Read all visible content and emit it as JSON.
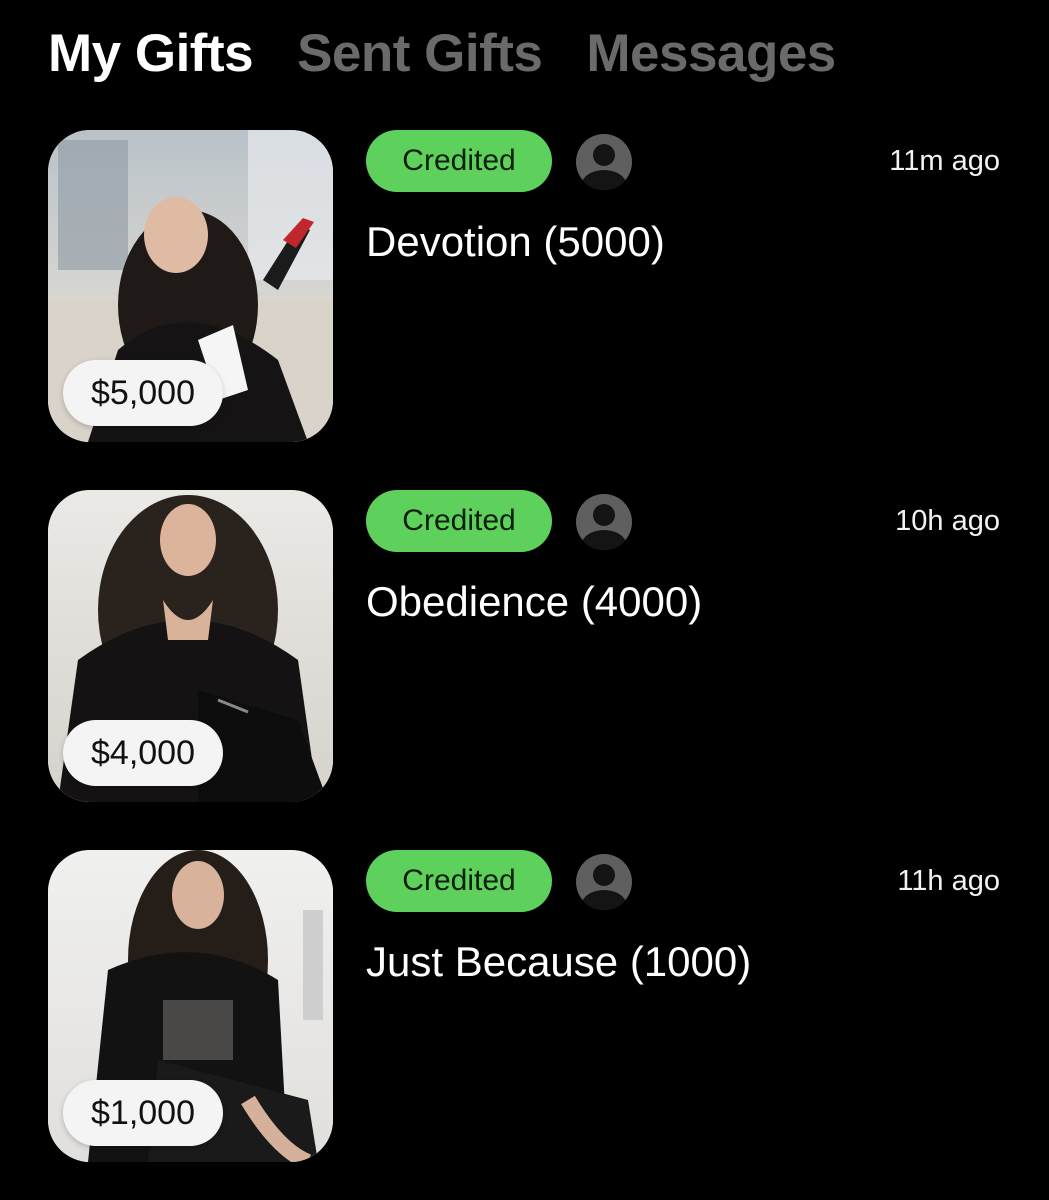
{
  "tabs": [
    {
      "label": "My Gifts",
      "active": true
    },
    {
      "label": "Sent Gifts",
      "active": false
    },
    {
      "label": "Messages",
      "active": false
    }
  ],
  "gifts": [
    {
      "price": "$5,000",
      "status": "Credited",
      "time": "11m ago",
      "name": "Devotion (5000)"
    },
    {
      "price": "$4,000",
      "status": "Credited",
      "time": "10h ago",
      "name": "Obedience (4000)"
    },
    {
      "price": "$1,000",
      "status": "Credited",
      "time": "11h ago",
      "name": "Just Because (1000)"
    }
  ],
  "colors": {
    "background": "#000000",
    "status_green": "#5ed15c",
    "tab_inactive": "#6a6a6a",
    "price_pill_bg": "#f4f4f4",
    "avatar_gray": "#5f5f5f"
  },
  "icons": {
    "avatar": "user-silhouette-icon"
  }
}
